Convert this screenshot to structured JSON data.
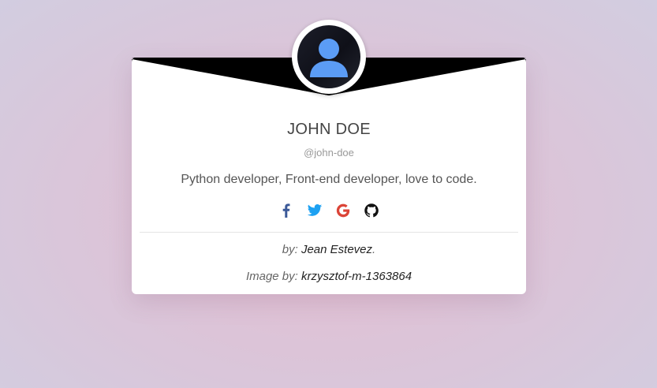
{
  "profile": {
    "name": "JOHN DOE",
    "handle": "@john-doe",
    "bio": "Python developer, Front-end developer, love to code."
  },
  "socials": [
    {
      "icon": "facebook-icon",
      "color": "#3b5998"
    },
    {
      "icon": "twitter-icon",
      "color": "#1da1f2"
    },
    {
      "icon": "google-icon",
      "color": "#db4437"
    },
    {
      "icon": "github-icon",
      "color": "#111111"
    }
  ],
  "credits": {
    "author_prefix": "by:",
    "author_name": "Jean Estevez",
    "author_suffix": ".",
    "image_prefix": "Image by:",
    "image_author": "krzysztof-m-1363864"
  },
  "colors": {
    "card_background": "#ffffff",
    "banner": "#000000",
    "avatar_icon": "#5b9cf5"
  }
}
